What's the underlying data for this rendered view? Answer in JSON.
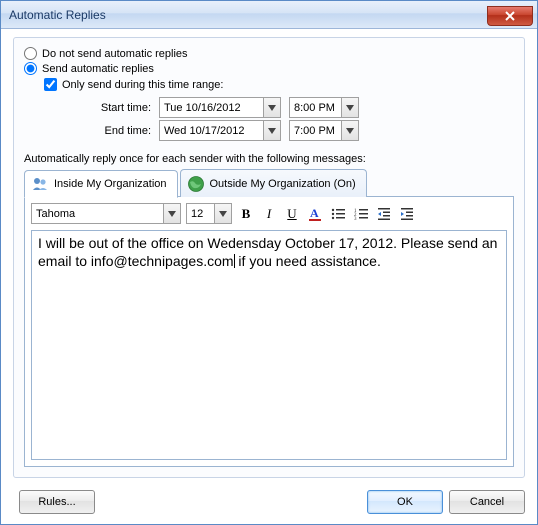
{
  "window": {
    "title": "Automatic Replies"
  },
  "options": {
    "do_not_send": "Do not send automatic replies",
    "send": "Send automatic replies",
    "only_range": "Only send during this time range:",
    "start_label": "Start time:",
    "end_label": "End time:",
    "start_date": "Tue 10/16/2012",
    "start_time": "8:00 PM",
    "end_date": "Wed 10/17/2012",
    "end_time": "7:00 PM",
    "selected": "send",
    "only_range_checked": true
  },
  "reply_section": {
    "label": "Automatically reply once for each sender with the following messages:"
  },
  "tabs": {
    "inside": "Inside My Organization",
    "outside": "Outside My Organization (On)",
    "active": "inside"
  },
  "toolbar": {
    "font": "Tahoma",
    "size": "12"
  },
  "editor": {
    "text_before_cursor": "I will be out of the office on Wedensday October 17, 2012. Please send an email to info@technipages.com",
    "text_after_cursor": " if you need assistance."
  },
  "buttons": {
    "rules": "Rules...",
    "ok": "OK",
    "cancel": "Cancel"
  }
}
